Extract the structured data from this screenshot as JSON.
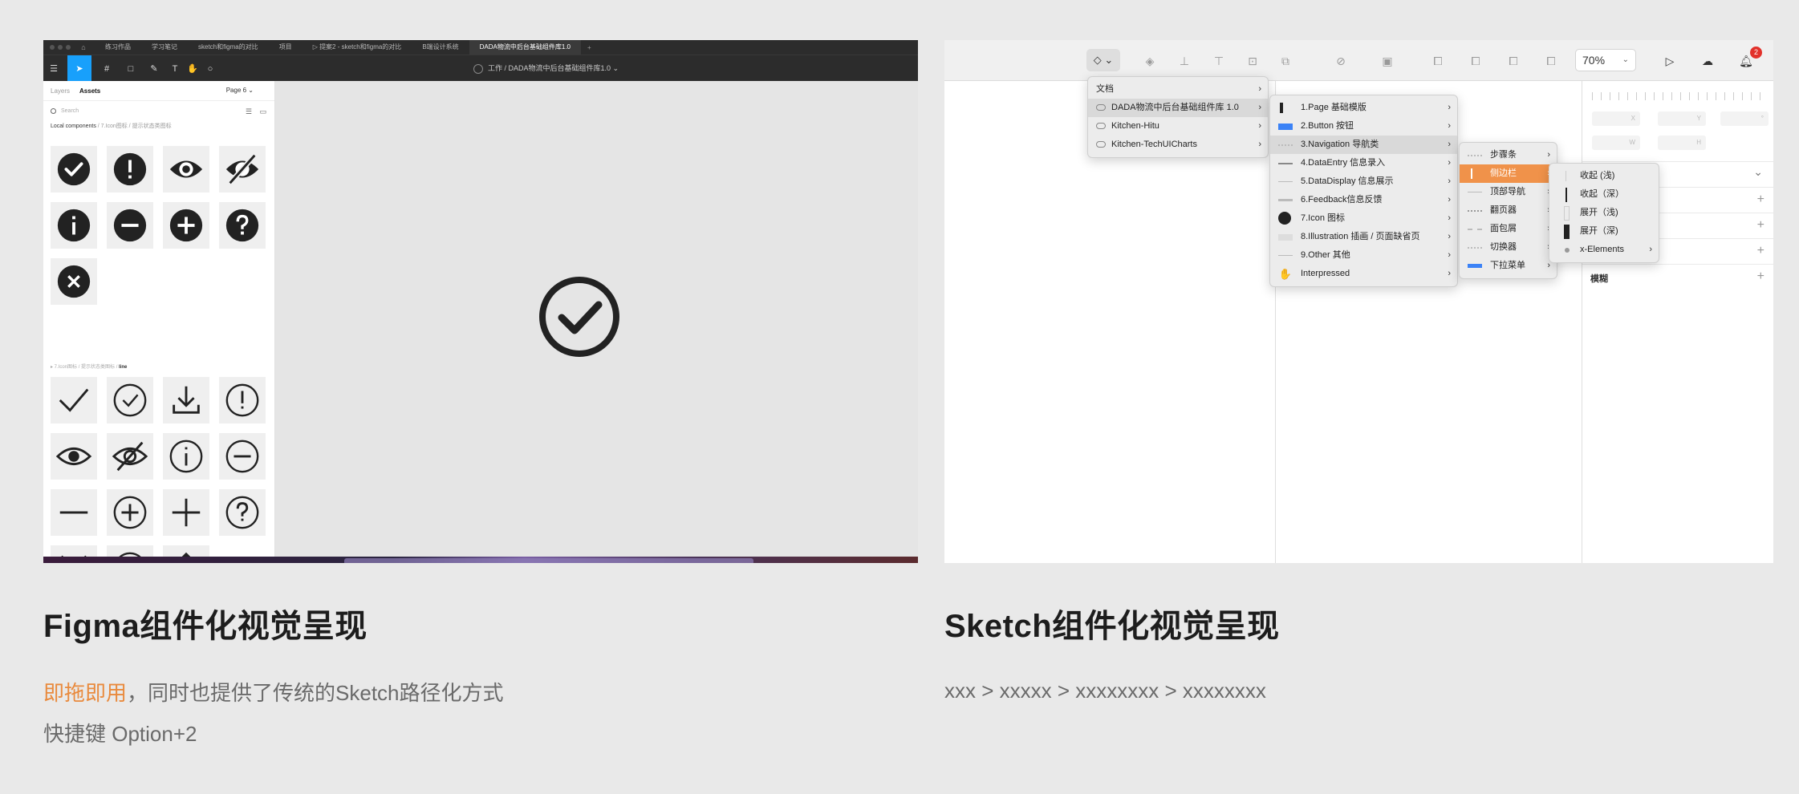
{
  "figma": {
    "tabs": [
      "练习作品",
      "学习笔记",
      "sketch和figma的对比",
      "项目",
      "▷ 提案2 - sketch和figma的对比",
      "B端设计系统",
      "DADA物流中后台基础组件库1.0",
      "+"
    ],
    "breadcrumb": "工作 / DADA物流中后台基础组件库1.0 ⌄",
    "sidebar": {
      "tab_layers": "Layers",
      "tab_assets": "Assets",
      "page": "Page 6 ⌄",
      "search_placeholder": "Search",
      "section_title": "Local components",
      "section_path": "/ 7.Icon图标 / 提示状态类图标",
      "section_sub": "▸ 7.Icon图标 / 提示状态类图标 /",
      "section_sub_bold": "line"
    },
    "solid_icons": [
      "check-solid-icon",
      "exclaim-solid-icon",
      "eye-solid-icon",
      "eye-off-solid-icon",
      "info-solid-icon",
      "minus-solid-icon",
      "plus-solid-icon",
      "question-solid-icon",
      "close-solid-icon"
    ],
    "line_icons": [
      "check-line-icon",
      "check-circle-line-icon",
      "download-line-icon",
      "exclaim-circle-line-icon",
      "eye-line-icon",
      "eye-off-line-icon",
      "info-circle-line-icon",
      "minus-circle-line-icon",
      "minus-line-icon",
      "plus-circle-line-icon",
      "plus-line-icon",
      "question-circle-line-icon",
      "close-line-icon",
      "close-circle-line-icon",
      "upload-line-icon"
    ]
  },
  "sketch": {
    "zoom": "70%",
    "notification_count": "2",
    "menu1": [
      "文档",
      "DADA物流中后台基础组件库 1.0",
      "Kitchen-Hitu",
      "Kitchen-TechUICharts"
    ],
    "menu2": [
      "1.Page 基础模版",
      "2.Button 按钮",
      "3.Navigation 导航类",
      "4.DataEntry 信息录入",
      "5.DataDisplay 信息展示",
      "6.Feedback信息反馈",
      "7.Icon 图标",
      "8.Illustration 插画 / 页面缺省页",
      "9.Other 其他",
      "Interpressed"
    ],
    "menu3": [
      "步骤条",
      "侧边栏",
      "顶部导航",
      "翻页器",
      "面包屑",
      "切换器",
      "下拉菜单"
    ],
    "menu4": [
      "收起 (浅)",
      "收起（深）",
      "展开（浅)",
      "展开（深)",
      "x-Elements"
    ],
    "inspector_label": "模糊"
  },
  "captions": {
    "figma_title": "Figma组件化视觉呈现",
    "figma_hi": "即拖即用",
    "figma_rest": "，同时也提供了传统的Sketch路径化方式",
    "figma_shortcut": "快捷键 Option+2",
    "sketch_title": "Sketch组件化视觉呈现",
    "sketch_path": "xxx > xxxxx > xxxxxxxx > xxxxxxxx"
  },
  "colors": {
    "accent_orange": "#e98a3d",
    "figma_blue": "#18a0fb",
    "menu_highlight": "#f0924a"
  }
}
